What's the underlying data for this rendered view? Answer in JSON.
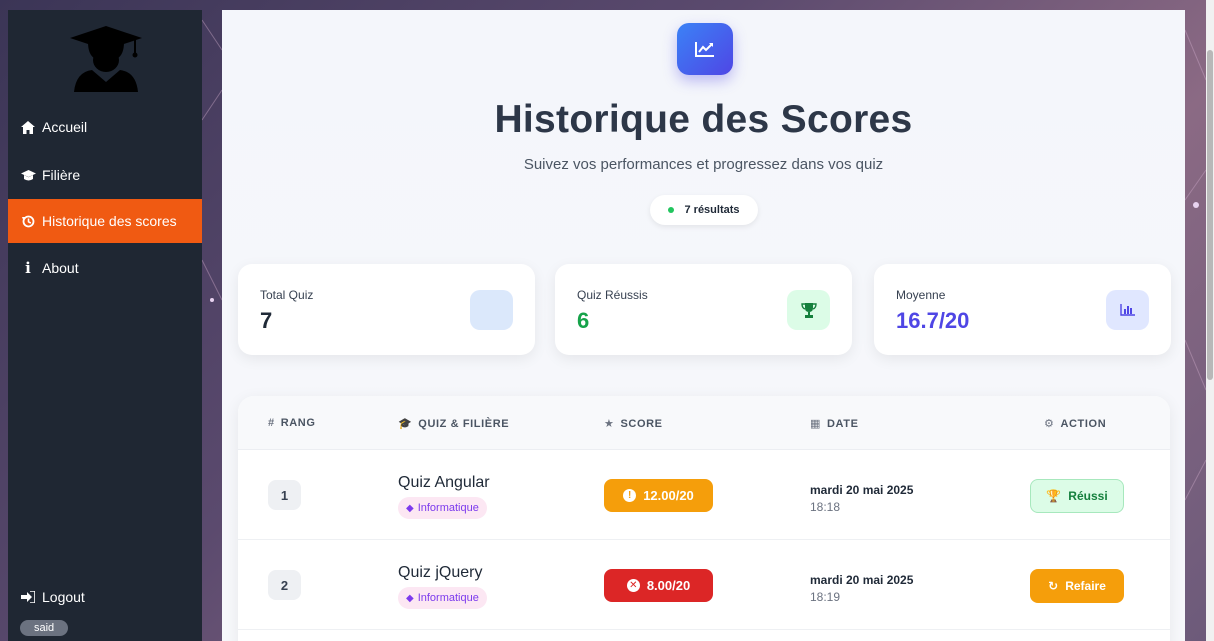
{
  "sidebar": {
    "items": [
      {
        "label": "Accueil",
        "icon": "home-icon"
      },
      {
        "label": "Filière",
        "icon": "graduation-cap-icon"
      },
      {
        "label": "Historique des scores",
        "icon": "history-icon"
      },
      {
        "label": "About",
        "icon": "info-icon"
      }
    ],
    "logout_label": "Logout",
    "user": "said",
    "active_color": "#f05a12"
  },
  "header": {
    "title": "Historique des Scores",
    "subtitle": "Suivez vos performances et progressez dans vos quiz",
    "count_label": "7 résultats"
  },
  "stats": [
    {
      "label": "Total Quiz",
      "value": "7",
      "color": "#1f2937"
    },
    {
      "label": "Quiz Réussis",
      "value": "6",
      "color": "#16a34a"
    },
    {
      "label": "Moyenne",
      "value": "16.7/20",
      "color": "#4f46e5"
    }
  ],
  "table": {
    "headers": [
      "RANG",
      "QUIZ & FILIÈRE",
      "SCORE",
      "DATE",
      "ACTION"
    ],
    "rows": [
      {
        "rank": "1",
        "quiz": "Quiz Angular",
        "filiere": "Informatique",
        "score": "12.00/20",
        "score_color": "#f59e0b",
        "date": "mardi 20 mai 2025",
        "time": "18:18",
        "action": "Réussi"
      },
      {
        "rank": "2",
        "quiz": "Quiz jQuery",
        "filiere": "Informatique",
        "score": "8.00/20",
        "score_color": "#dc2626",
        "date": "mardi 20 mai 2025",
        "time": "18:19",
        "action": "Refaire"
      }
    ]
  }
}
